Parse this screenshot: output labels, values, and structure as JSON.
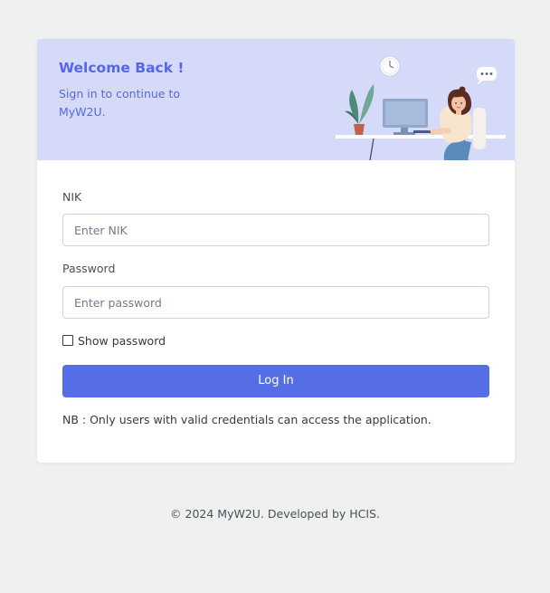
{
  "header": {
    "title": "Welcome Back !",
    "subtitle": "Sign in to continue to MyW2U."
  },
  "form": {
    "nik_label": "NIK",
    "nik_placeholder": "Enter NIK",
    "nik_value": "",
    "password_label": "Password",
    "password_placeholder": "Enter password",
    "password_value": "",
    "show_password_label": "Show password",
    "show_password_checked": false,
    "login_label": "Log In",
    "note": "NB : Only users with valid credentials can access the application."
  },
  "footer": {
    "text": "© 2024 MyW2U. Developed by HCIS."
  },
  "colors": {
    "page_background": "#eff0f0",
    "header_background": "#d5daf8",
    "accent": "#556ee6",
    "card": "#ffffff"
  },
  "icons": [
    "clock-icon",
    "chat-bubble-icon",
    "plant-icon",
    "monitor-icon",
    "woman-working-illustration"
  ]
}
